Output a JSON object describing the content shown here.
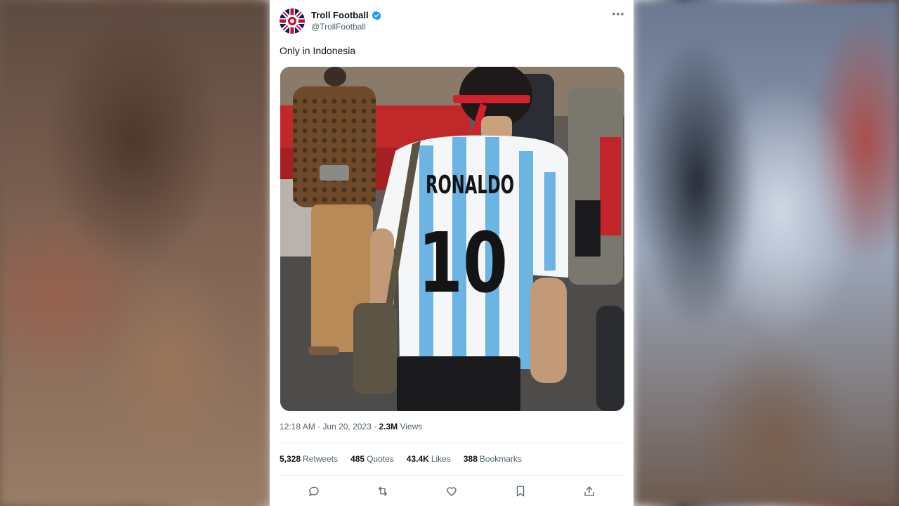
{
  "tweet": {
    "display_name": "Troll Football",
    "handle": "@TrollFootball",
    "text": "Only in Indonesia",
    "time": "12:18 AM",
    "date": "Jun 20, 2023",
    "separator": "·",
    "views_count": "2.3M",
    "views_label": "Views",
    "media_alt_jersey_name": "RONALDO",
    "media_alt_jersey_number": "10"
  },
  "stats": {
    "retweets_count": "5,328",
    "retweets_label": "Retweets",
    "quotes_count": "485",
    "quotes_label": "Quotes",
    "likes_count": "43.4K",
    "likes_label": "Likes",
    "bookmarks_count": "388",
    "bookmarks_label": "Bookmarks"
  },
  "icons": {
    "more": "more-icon",
    "reply": "reply-icon",
    "retweet": "retweet-icon",
    "like": "heart-icon",
    "bookmark": "bookmark-icon",
    "share": "share-icon",
    "verified": "verified-badge-icon"
  },
  "colors": {
    "verified": "#1d9bf0",
    "text_primary": "#0f1419",
    "text_secondary": "#536471",
    "argentina_blue": "#6cb4e4"
  }
}
